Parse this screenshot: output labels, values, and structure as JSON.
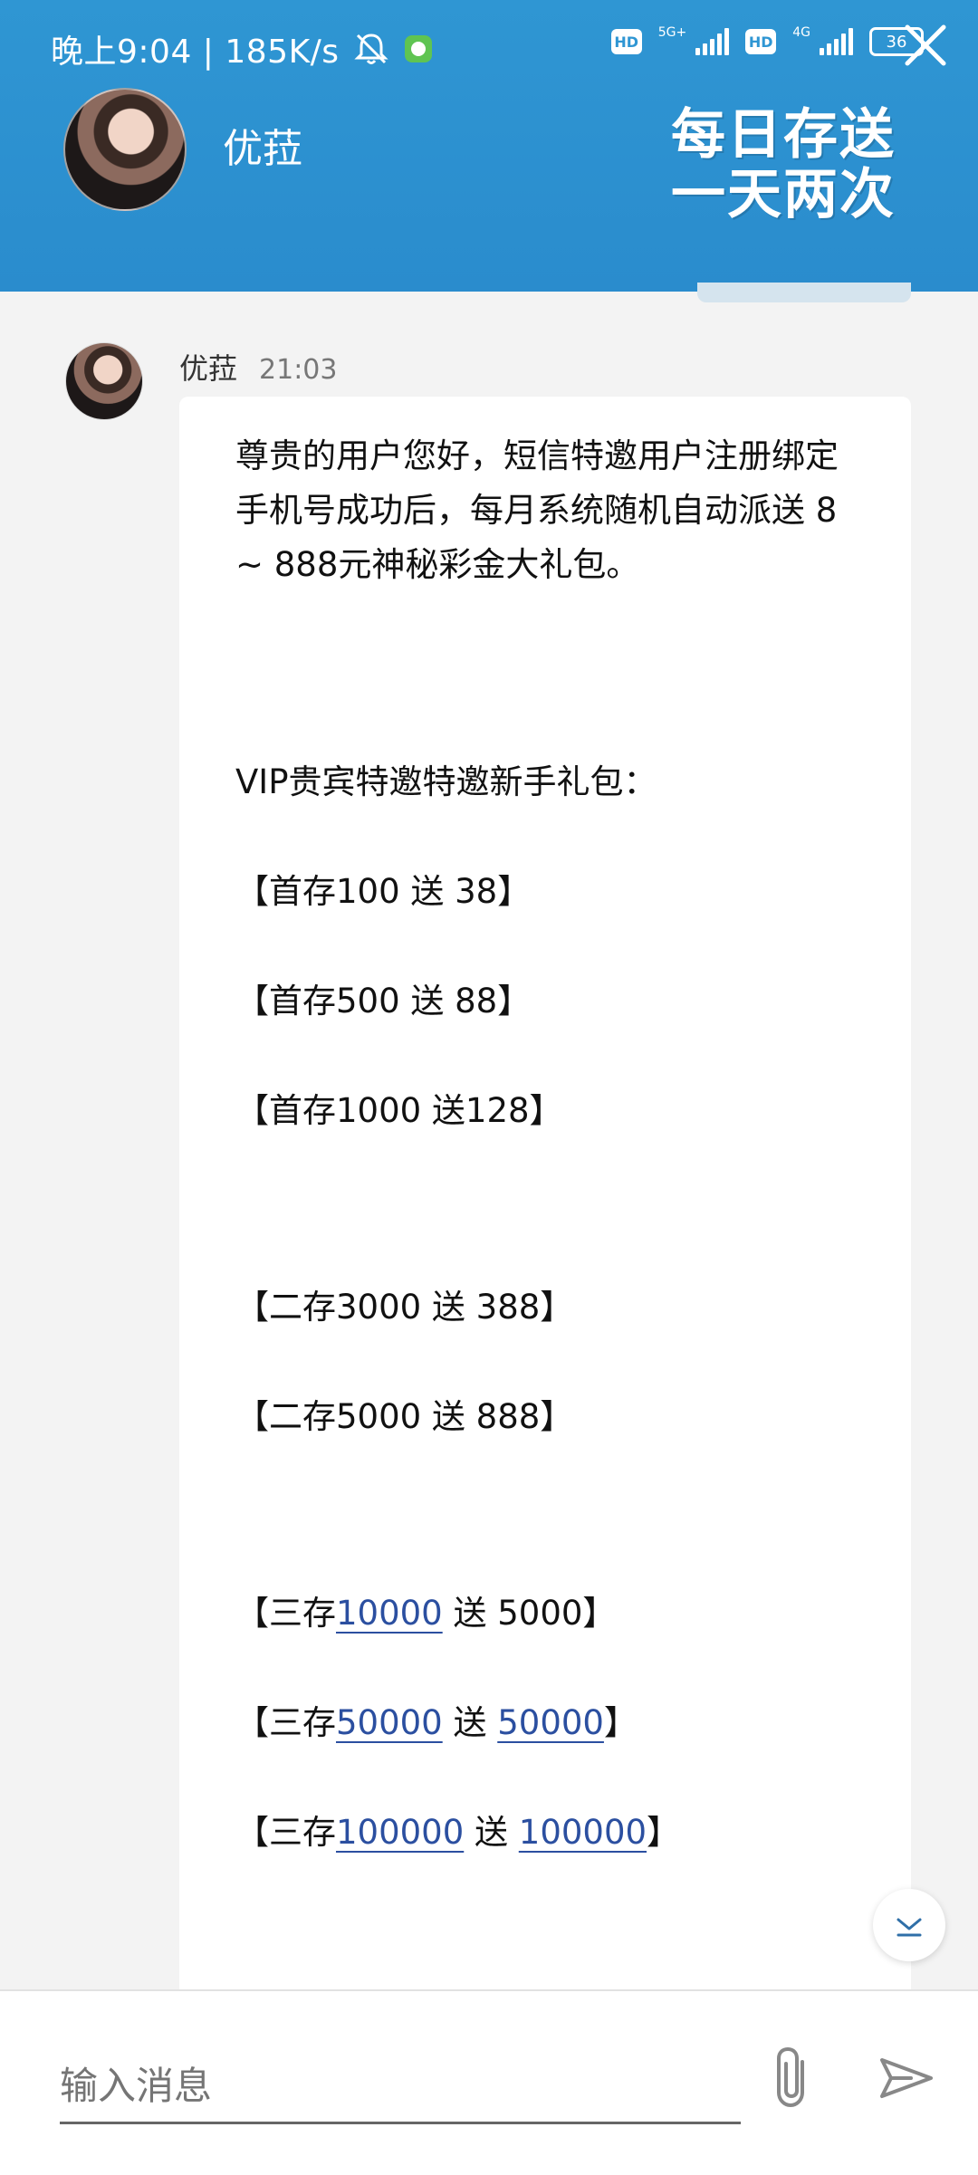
{
  "status_bar": {
    "time_speed": "晚上9:04 | 185K/s",
    "network_1": "5G+",
    "network_2": "4G",
    "hd_1": "HD",
    "hd_2": "HD",
    "battery": "36"
  },
  "header": {
    "contact_name": "优菈",
    "promo_line_1": "每日存送",
    "promo_line_2": "一天两次"
  },
  "message": {
    "sender": "优菈",
    "time": "21:03",
    "intro": "尊贵的用户您好，短信特邀用户注册绑定手机号成功后，每月系统随机自动派送 8 ~ 888元神秘彩金大礼包。",
    "vip_title": "VIP贵宾特邀特邀新手礼包：",
    "offers_first": [
      "【首存100 送 38】",
      "【首存500 送 88】",
      "【首存1000 送128】"
    ],
    "offers_second": [
      "【二存3000 送 388】",
      "【二存5000 送 888】"
    ],
    "offers_third": [
      {
        "prefix": "【三存",
        "deposit": "10000",
        "mid": " 送 ",
        "bonus": "5000",
        "bonus_link": false,
        "suffix": "】"
      },
      {
        "prefix": "【三存",
        "deposit": "50000",
        "mid": " 送 ",
        "bonus": "50000",
        "bonus_link": true,
        "suffix": "】"
      },
      {
        "prefix": "【三存",
        "deposit": "100000",
        "mid": " 送 ",
        "bonus": "100000",
        "bonus_link": true,
        "suffix": "】"
      }
    ]
  },
  "input": {
    "placeholder": "输入消息"
  },
  "colors": {
    "header_bg": "#2f96d3",
    "link": "#2b4fa0",
    "bubble_bg": "#ffffff",
    "chat_bg": "#f3f3f3"
  },
  "icons": {
    "mute": "bell-off-icon",
    "app": "notification-app-icon",
    "close": "close-icon",
    "scroll": "chevron-down-icon",
    "attach": "paperclip-icon",
    "send": "send-icon"
  }
}
